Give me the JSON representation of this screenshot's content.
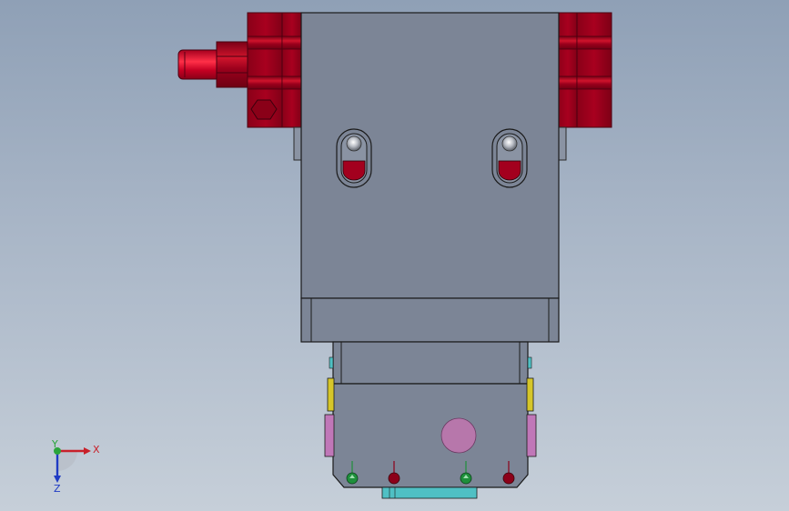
{
  "viewport": {
    "background_top": "#8fa0b6",
    "background_bottom": "#c6cfd9"
  },
  "colors": {
    "body_gray": "#7c8596",
    "body_gray_light": "#8a93a3",
    "outline": "#1a1a1a",
    "fitting_red": "#8c0019",
    "fitting_red_highlight": "#d8162f",
    "accent_cyan": "#4fc0c4",
    "accent_yellow": "#d6c62a",
    "accent_magenta": "#c077b8",
    "pink_circle": "#b777ab",
    "indicator_green": "#1e8f3b",
    "indicator_red": "#8c0019"
  },
  "triad": {
    "x_label": "X",
    "y_label": "Y",
    "z_label": "Z",
    "x_color": "#c8202a",
    "y_color": "#2aa43a",
    "z_color": "#1f3bc4"
  }
}
